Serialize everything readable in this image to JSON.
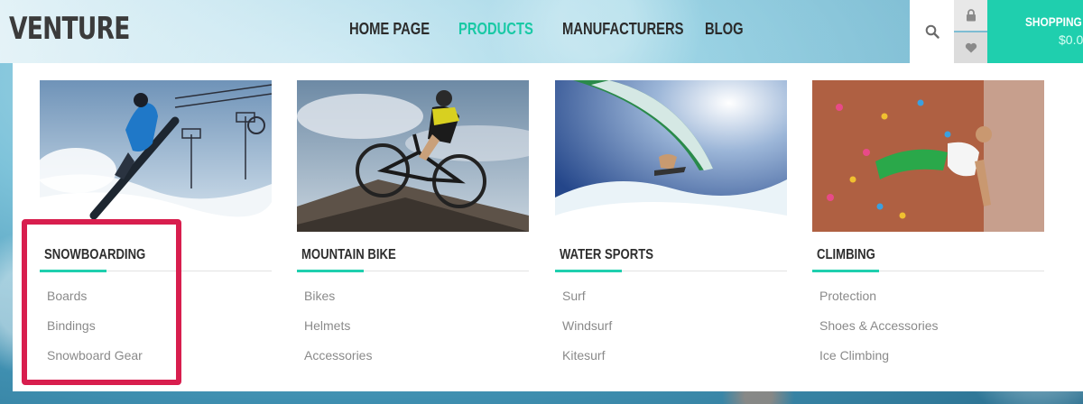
{
  "brand": {
    "logo": "VENTURE"
  },
  "nav": {
    "items": [
      {
        "label": "HOME PAGE",
        "active": false
      },
      {
        "label": "PRODUCTS",
        "active": true
      },
      {
        "label": "MANUFACTURERS",
        "active": false
      },
      {
        "label": "BLOG",
        "active": false
      }
    ]
  },
  "header_actions": {
    "search_icon": "search-icon",
    "lock_icon": "lock-icon",
    "heart_icon": "heart-icon",
    "cart_label": "SHOPPING C",
    "cart_total": "$0.0"
  },
  "menu": {
    "columns": [
      {
        "title": "SNOWBOARDING",
        "image": "snowboarder-photo",
        "links": [
          "Boards",
          "Bindings",
          "Snowboard Gear"
        ]
      },
      {
        "title": "MOUNTAIN BIKE",
        "image": "mountain-biker-photo",
        "links": [
          "Bikes",
          "Helmets",
          "Accessories"
        ]
      },
      {
        "title": "WATER SPORTS",
        "image": "windsurfer-photo",
        "links": [
          "Surf",
          "Windsurf",
          "Kitesurf"
        ]
      },
      {
        "title": "CLIMBING",
        "image": "climber-photo",
        "links": [
          "Protection",
          "Shoes & Accessories",
          "Ice Climbing"
        ]
      }
    ]
  },
  "colors": {
    "accent": "#1fcfae",
    "active_nav": "#19c9a5",
    "highlight": "#d81e4e"
  }
}
